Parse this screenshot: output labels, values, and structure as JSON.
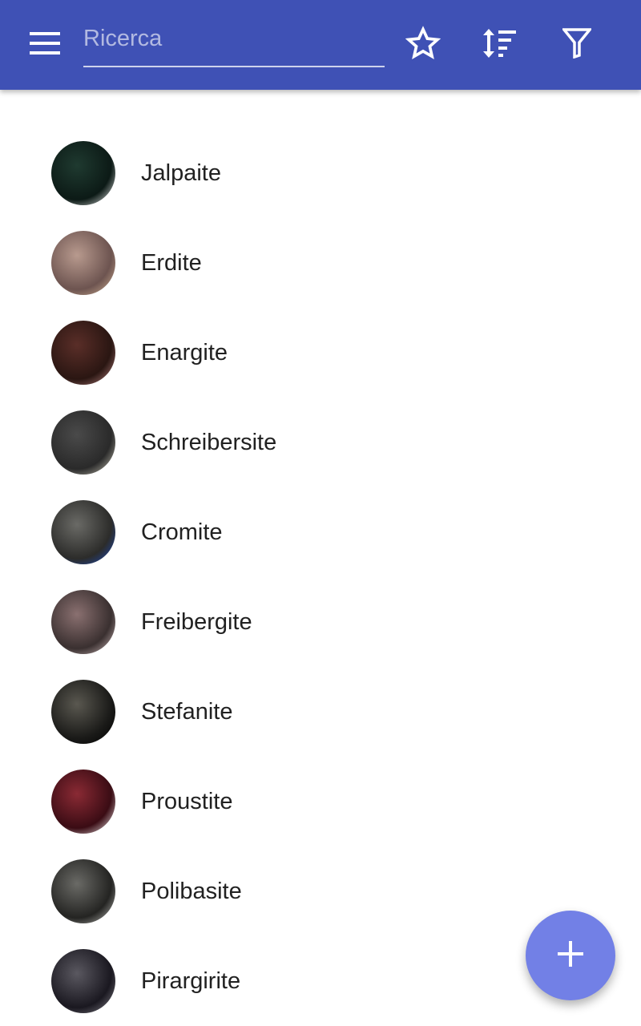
{
  "colors": {
    "toolbar": "#3F51B5",
    "fab": "#7280E6",
    "text": "#212121"
  },
  "toolbar": {
    "menu_icon": "menu-icon",
    "search_placeholder": "Ricerca",
    "search_value": "",
    "favorite_icon": "star-outline-icon",
    "sort_icon": "sort-icon",
    "filter_icon": "filter-icon"
  },
  "minerals": [
    {
      "name": "Jalpaite",
      "colors": [
        "#1f3a30",
        "#0c1a16",
        "#ffffff"
      ]
    },
    {
      "name": "Erdite",
      "colors": [
        "#b89a8e",
        "#6d5450",
        "#d8b89a"
      ]
    },
    {
      "name": "Enargite",
      "colors": [
        "#5a2e28",
        "#2a1612",
        "#c08a88"
      ]
    },
    {
      "name": "Schreibersite",
      "colors": [
        "#4a4a4a",
        "#2a2a2a",
        "#d8d4c4"
      ]
    },
    {
      "name": "Cromite",
      "colors": [
        "#6a6a66",
        "#2c2c2a",
        "#1a4cc8"
      ]
    },
    {
      "name": "Freibergite",
      "colors": [
        "#8a7070",
        "#3a3030",
        "#d8c4c4"
      ]
    },
    {
      "name": "Stefanite",
      "colors": [
        "#5a5850",
        "#1a1a18",
        "#000000"
      ]
    },
    {
      "name": "Proustite",
      "colors": [
        "#8a2a34",
        "#3a0c14",
        "#ffffff"
      ]
    },
    {
      "name": "Polibasite",
      "colors": [
        "#6a6a66",
        "#242422",
        "#c8c8c4"
      ]
    },
    {
      "name": "Pirargirite",
      "colors": [
        "#5a5860",
        "#1a1820",
        "#8a8890"
      ]
    }
  ],
  "fab": {
    "icon": "add-icon"
  }
}
